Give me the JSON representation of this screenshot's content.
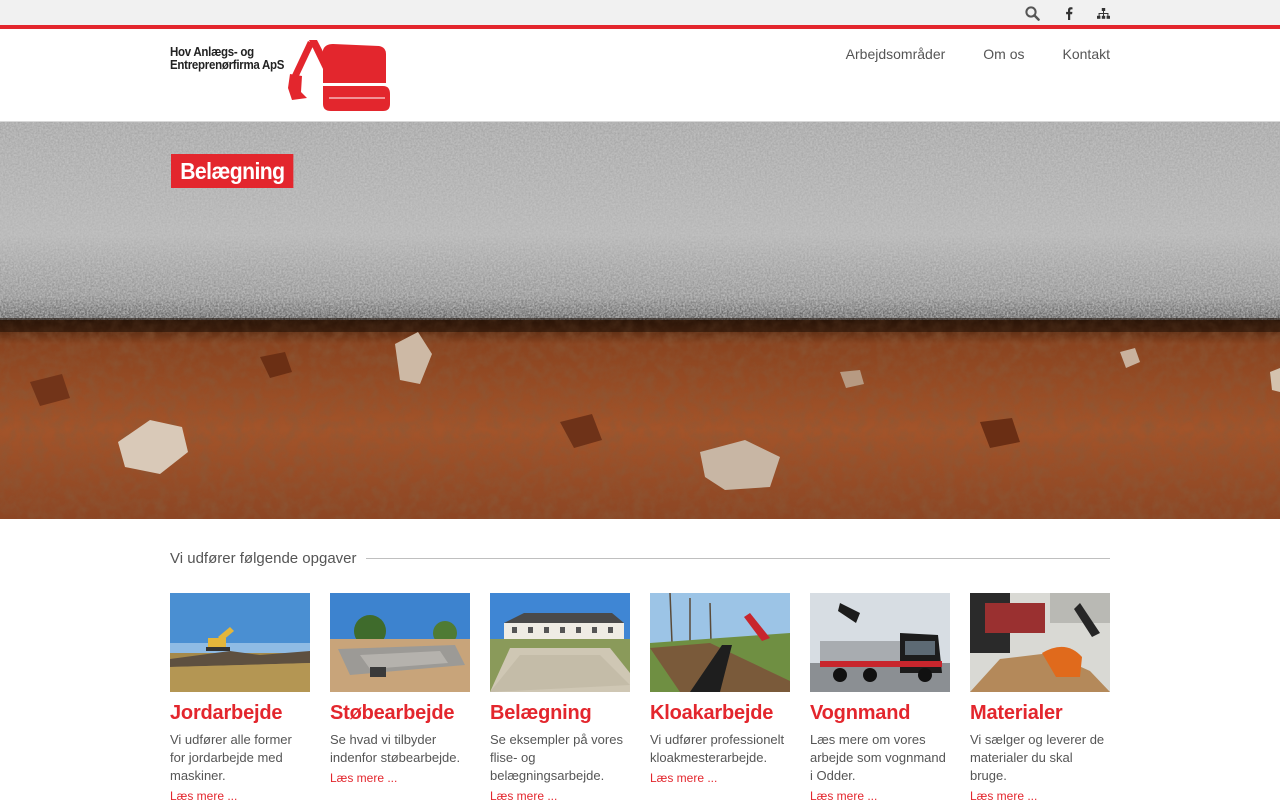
{
  "topbar": {
    "icons": [
      "search-icon",
      "facebook-icon",
      "sitemap-icon"
    ],
    "accent": "#e3262d"
  },
  "logo": {
    "line1": "Hov Anlægs- og",
    "line2": "Entreprenørfirma ApS"
  },
  "nav": {
    "items": [
      "Arbejdsområder",
      "Om os",
      "Kontakt"
    ]
  },
  "hero": {
    "badge": "Belægning"
  },
  "section": {
    "heading": "Vi udfører følgende opgaver"
  },
  "cards": [
    {
      "title": "Jordarbejde",
      "desc": "Vi udfører alle former for jordarbejde med maskiner.",
      "more": "Læs mere ..."
    },
    {
      "title": "Støbearbejde",
      "desc": "Se hvad vi tilbyder indenfor støbearbejde.",
      "more": "Læs mere ..."
    },
    {
      "title": "Belægning",
      "desc": "Se eksempler på vores flise- og belægningsarbejde.",
      "more": "Læs mere ..."
    },
    {
      "title": "Kloakarbejde",
      "desc": "Vi udfører professionelt kloakmesterarbejde.",
      "more": "Læs mere ..."
    },
    {
      "title": "Vognmand",
      "desc": "Læs mere om vores arbejde som vognmand i Odder.",
      "more": "Læs mere ..."
    },
    {
      "title": "Materialer",
      "desc": "Vi sælger og leverer de materialer du skal bruge.",
      "more": "Læs mere ..."
    }
  ],
  "colors": {
    "accent": "#e3262d",
    "text": "#555555"
  }
}
